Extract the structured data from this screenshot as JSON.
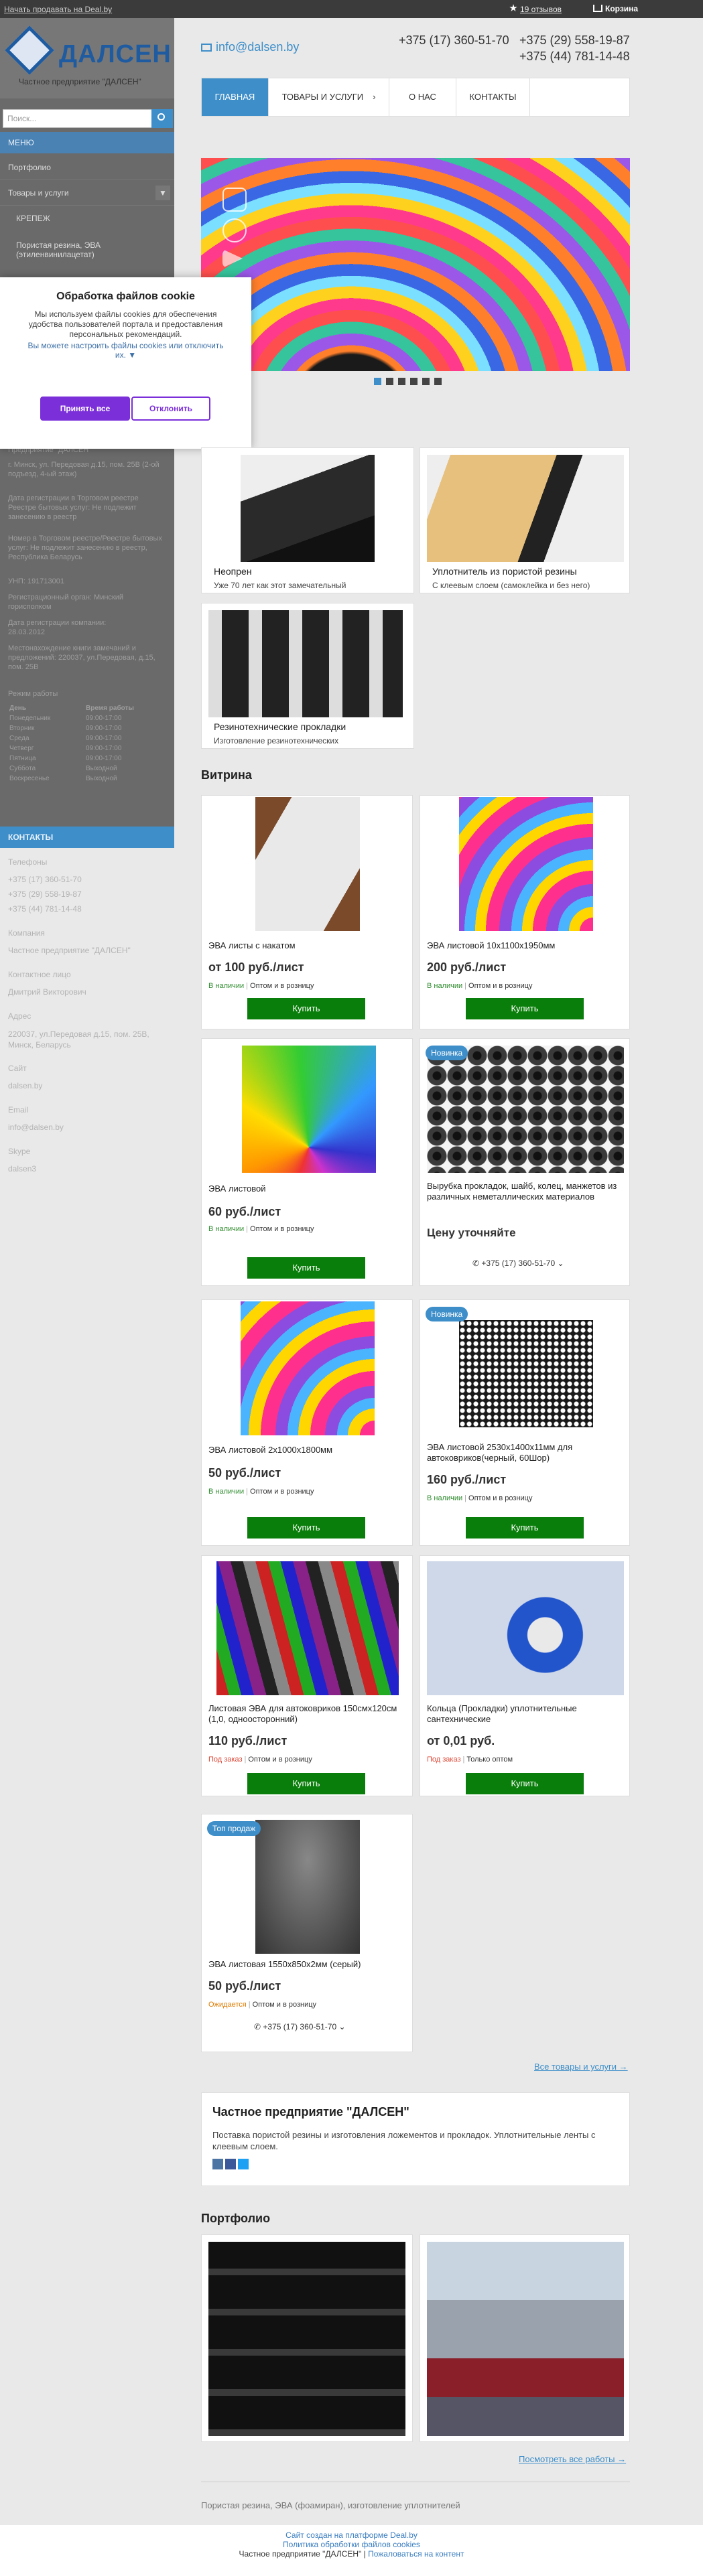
{
  "topbar": {
    "sell": "Начать продавать на Deal.by",
    "reviews": "19 отзывов",
    "cart": "Корзина"
  },
  "brand": {
    "logo": "ДАЛСЕН",
    "subtitle": "Частное предприятие \"ДАЛСЕН\""
  },
  "search": {
    "placeholder": "Поиск..."
  },
  "sidebar": {
    "menu_title": "МЕНЮ",
    "items": [
      "Портфолио",
      "Товары и услуги",
      "КРЕПЕЖ",
      "Пористая резина, ЭВА (этиленвинилацетат)"
    ],
    "info": {
      "name": "Предприятие \"ДАЛСЕН\"",
      "address": "г. Минск, ул. Передовая д.15, пом. 25В (2-ой подъезд, 4-ый этаж)",
      "reg_date_label": "Дата регистрации в Торговом реестре Реестре бытовых услуг: Не подлежит занесению в реестр",
      "reg_num": "Номер в Торговом реестре/Реестре бытовых услуг: Не подлежит занесению в реестр, Республика Беларусь",
      "unp": "УНП: 191713001",
      "reg_organ": "Регистрационный орган: Минский горисполком",
      "company_reg": "Дата регистрации компании: 28.03.2012",
      "book_location": "Местонахождение книги замечаний и предложений: 220037, ул.Передовая, д.15, пом. 25В",
      "mode_title": "Режим работы"
    },
    "hours_head": [
      "День",
      "Время работы"
    ],
    "hours": [
      [
        "Понедельник",
        "09:00-17:00"
      ],
      [
        "Вторник",
        "09:00-17:00"
      ],
      [
        "Среда",
        "09:00-17:00"
      ],
      [
        "Четверг",
        "09:00-17:00"
      ],
      [
        "Пятница",
        "09:00-17:00"
      ],
      [
        "Суббота",
        "Выходной"
      ],
      [
        "Воскресенье",
        "Выходной"
      ]
    ],
    "contacts_title": "КОНТАКТЫ",
    "contacts": {
      "phones_label": "Телефоны",
      "phones": [
        "+375 (17) 360-51-70",
        "+375 (29) 558-19-87",
        "+375 (44) 781-14-48"
      ],
      "company_label": "Компания",
      "company": "Частное предприятие \"ДАЛСЕН\"",
      "person_label": "Контактное лицо",
      "person": "Дмитрий Викторович",
      "address_label": "Адрес",
      "address": "220037, ул.Передовая д.15, пом. 25В, Минск, Беларусь",
      "site_label": "Сайт",
      "site": "dalsen.by",
      "email_label": "Email",
      "email": "info@dalsen.by",
      "skype_label": "Skype",
      "skype": "dalsen3"
    }
  },
  "cookie": {
    "title": "Обработка файлов cookie",
    "text": "Мы используем файлы cookies для обеспечения удобства пользователей портала и предоставления персональных рекомендаций.",
    "configure": "Вы можете настроить файлы cookies или отключить их. ▼",
    "accept": "Принять все",
    "reject": "Отклонить"
  },
  "header": {
    "email": "info@dalsen.by",
    "phones": [
      "+375 (17) 360-51-70",
      "+375 (29) 558-19-87",
      "+375 (44) 781-14-48"
    ]
  },
  "nav": [
    "ГЛАВНАЯ",
    "ТОВАРЫ И УСЛУГИ",
    "О НАС",
    "КОНТАКТЫ"
  ],
  "categories": [
    {
      "title": "Неопрен",
      "desc": "Уже 70 лет как этот замечательный"
    },
    {
      "title": "Уплотнитель из пористой резины",
      "desc": "С клеевым слоем (самоклейка и без него)"
    },
    {
      "title": "Резинотехнические прокладки",
      "desc": "Изготовление резинотехнических"
    }
  ],
  "vitrina_title": "Витрина",
  "products": [
    {
      "name": "ЭВА листы с накатом",
      "price": "от 100 руб./лист",
      "status": "В наличии",
      "type": "Оптом и в розницу",
      "action": "Купить"
    },
    {
      "name": "ЭВА листовой 10х1100х1950мм",
      "price": "200 руб./лист",
      "status": "В наличии",
      "type": "Оптом и в розницу",
      "action": "Купить"
    },
    {
      "name": "ЭВА листовой",
      "price": "60 руб./лист",
      "status": "В наличии",
      "type": "Оптом и в розницу",
      "action": "Купить"
    },
    {
      "badge": "Новинка",
      "name": "Вырубка прокладок, шайб, колец, манжетов из различных неметаллических материалов",
      "price": "Цену уточняйте",
      "phone": "+375 (17) 360-51-70 ⌄"
    },
    {
      "name": "ЭВА листовой 2х1000х1800мм",
      "price": "50 руб./лист",
      "status": "В наличии",
      "type": "Оптом и в розницу",
      "action": "Купить"
    },
    {
      "badge": "Новинка",
      "name": "ЭВА листовой 2530х1400х11мм для автоковриков(черный, 60Шор)",
      "price": "160 руб./лист",
      "status": "В наличии",
      "type": "Оптом и в розницу",
      "action": "Купить"
    },
    {
      "name": "Листовая ЭВА для автоковриков 150смх120см (1,0, одноосторонний)",
      "price": "110 руб./лист",
      "status": "Под заказ",
      "type": "Оптом и в розницу",
      "action": "Купить"
    },
    {
      "name": "Кольца (Прокладки) уплотнительные сантехнические",
      "price": "от 0,01 руб.",
      "status": "Под заказ",
      "type": "Только оптом",
      "action": "Купить"
    },
    {
      "badge": "Топ продаж",
      "name": "ЭВА листовая 1550х850х2мм (серый)",
      "price": "50 руб./лист",
      "status": "Ожидается",
      "type": "Оптом и в розницу",
      "phone": "+375 (17) 360-51-70 ⌄"
    }
  ],
  "all_products": "Все товары и услуги →",
  "company": {
    "title": "Частное предприятие \"ДАЛСЕН\"",
    "text": "Поставка пористой резины и изготовления ложементов и прокладок. Уплотнительные ленты с клеевым слоем."
  },
  "portfolio_title": "Портфолио",
  "all_portfolio": "Посмотреть все работы →",
  "footer_text": "Пористая резина, ЭВА (фоамиран), изготовление уплотнителей",
  "bottom": {
    "line1": "Сайт создан на платформе Deal.by",
    "line2": "Политика обработки файлов cookies",
    "line3a": "Частное предприятие \"ДАЛСЕН\" | ",
    "line3b": "Пожаловаться на контент"
  },
  "colors": {
    "accent": "#3d8ec9",
    "buy": "#0a7e0a",
    "cookie_btn": "#7b2fd9",
    "brand": "#1e5ba0"
  }
}
